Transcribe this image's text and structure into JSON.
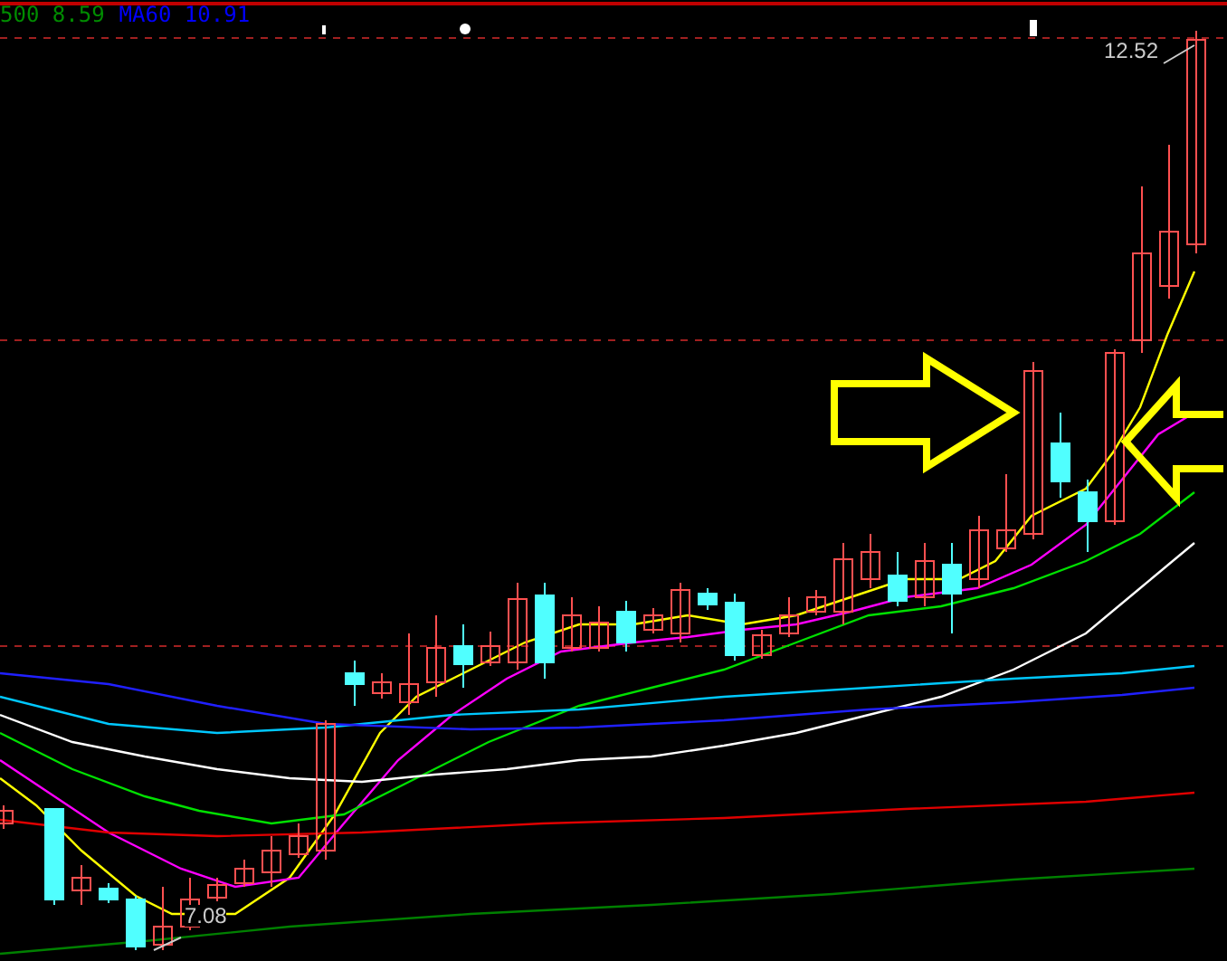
{
  "legend": [
    {
      "text": "500 8.59",
      "color": "#008c00"
    },
    {
      "text": "MA60 10.91",
      "color": "#0000ff"
    }
  ],
  "price_labels": [
    {
      "text": "12.52"
    },
    {
      "text": "7.08"
    }
  ]
}
